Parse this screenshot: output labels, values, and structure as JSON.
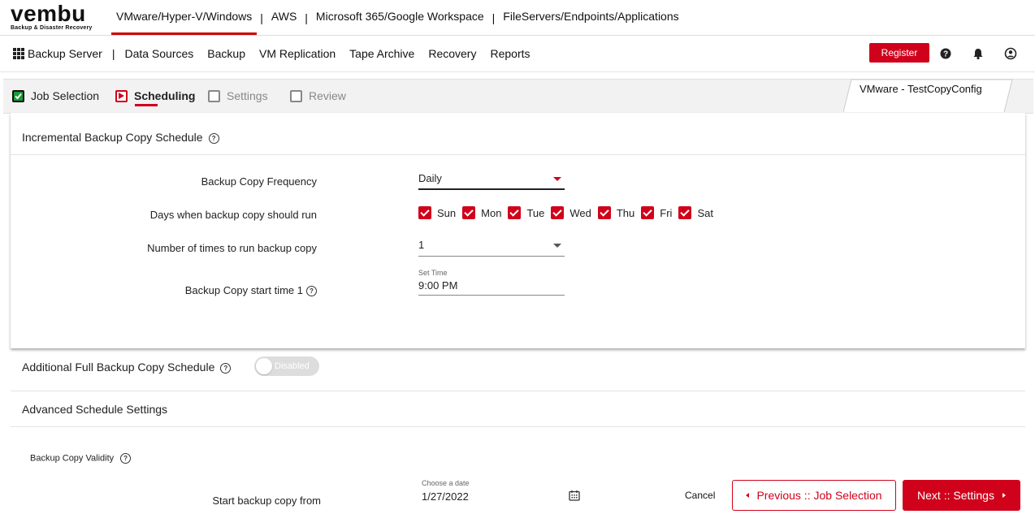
{
  "brand": {
    "name": "vembu",
    "tagline": "Backup & Disaster Recovery"
  },
  "primary_nav": {
    "items": [
      "VMware/Hyper-V/Windows",
      "AWS",
      "Microsoft 365/Google Workspace",
      "FileServers/Endpoints/Applications"
    ],
    "separator": "|"
  },
  "secondary_nav": {
    "backup_server": "Backup Server",
    "separator": "|",
    "items": [
      "Data Sources",
      "Backup",
      "VM Replication",
      "Tape Archive",
      "Recovery",
      "Reports"
    ]
  },
  "header_actions": {
    "register": "Register",
    "icons": [
      "help-icon",
      "bell-icon",
      "user-icon"
    ]
  },
  "wizard": {
    "steps": [
      {
        "label": "Job Selection",
        "state": "done"
      },
      {
        "label": "Scheduling",
        "state": "current"
      },
      {
        "label": "Settings",
        "state": "pending"
      },
      {
        "label": "Review",
        "state": "pending"
      }
    ],
    "job_name": "VMware - TestCopyConfig"
  },
  "incremental": {
    "title": "Incremental Backup Copy Schedule",
    "help": "?",
    "frequency": {
      "label": "Backup Copy Frequency",
      "value": "Daily"
    },
    "days": {
      "label": "Days when backup copy should run",
      "items": [
        {
          "label": "Sun",
          "checked": true
        },
        {
          "label": "Mon",
          "checked": true
        },
        {
          "label": "Tue",
          "checked": true
        },
        {
          "label": "Wed",
          "checked": true
        },
        {
          "label": "Thu",
          "checked": true
        },
        {
          "label": "Fri",
          "checked": true
        },
        {
          "label": "Sat",
          "checked": true
        }
      ]
    },
    "times": {
      "label": "Number of times to run backup copy",
      "value": "1"
    },
    "start_time": {
      "label": "Backup Copy start time 1",
      "caption": "Set Time",
      "value": "9:00 PM"
    }
  },
  "full_backup": {
    "title": "Additional Full Backup Copy Schedule",
    "toggle": "Disabled"
  },
  "advanced": {
    "title": "Advanced Schedule Settings"
  },
  "validity": {
    "title": "Backup Copy Validity",
    "start_label": "Start backup copy from",
    "date_caption": "Choose a date",
    "date_value": "1/27/2022"
  },
  "footer": {
    "cancel": "Cancel",
    "prev": "Previous :: Job Selection",
    "next": "Next :: Settings"
  },
  "colors": {
    "accent": "#d0021b",
    "done": "#1a9a3a"
  }
}
